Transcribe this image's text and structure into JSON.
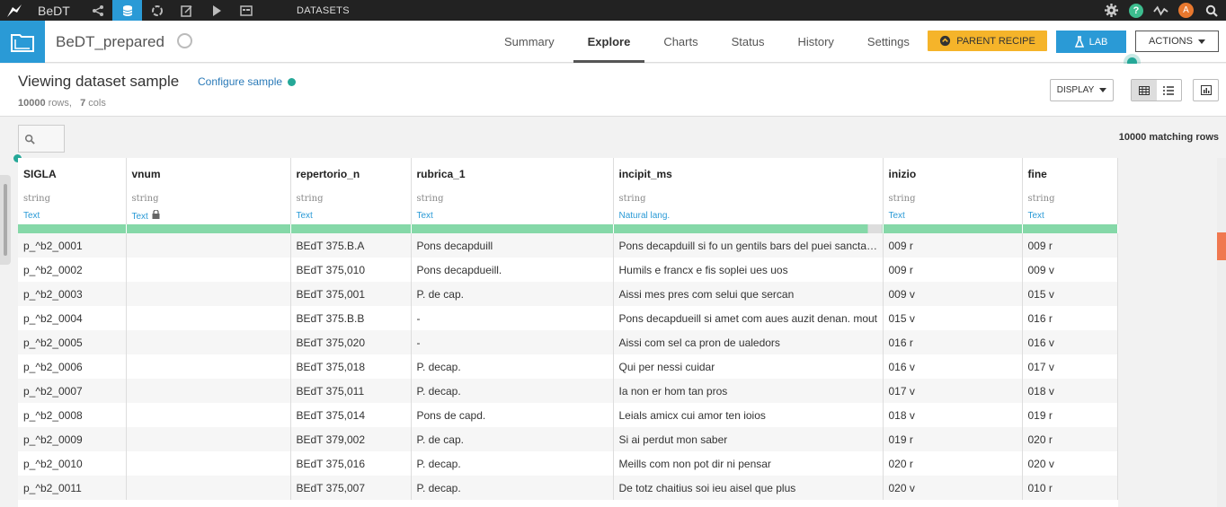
{
  "topbar": {
    "project_name": "BeDT",
    "section_label": "DATASETS"
  },
  "dataset": {
    "name": "BeDT_prepared"
  },
  "tabs": [
    {
      "label": "Summary"
    },
    {
      "label": "Explore"
    },
    {
      "label": "Charts"
    },
    {
      "label": "Status"
    },
    {
      "label": "History"
    },
    {
      "label": "Settings"
    }
  ],
  "active_tab": "Explore",
  "buttons": {
    "parent_recipe": "PARENT RECIPE",
    "lab": "LAB",
    "actions": "ACTIONS",
    "display": "DISPLAY"
  },
  "sample": {
    "title": "Viewing dataset sample",
    "configure": "Configure sample",
    "rows_count": "10000",
    "rows_label": "rows,",
    "cols_count": "7",
    "cols_label": "cols"
  },
  "matching": "10000 matching rows",
  "colors": {
    "accent": "#2a9ad6",
    "parent_recipe": "#f5b42a",
    "quality": "#85d8a8",
    "teal_dot": "#25a898",
    "avatar": "#e8782e"
  },
  "avatar_letter": "A",
  "help_symbol": "?",
  "columns": [
    {
      "name": "SIGLA",
      "type": "string",
      "meaning": "Text"
    },
    {
      "name": "vnum",
      "type": "string",
      "meaning": "Text"
    },
    {
      "name": "repertorio_n",
      "type": "string",
      "meaning": "Text"
    },
    {
      "name": "rubrica_1",
      "type": "string",
      "meaning": "Text"
    },
    {
      "name": "incipit_ms",
      "type": "string",
      "meaning": "Natural lang."
    },
    {
      "name": "inizio",
      "type": "string",
      "meaning": "Text"
    },
    {
      "name": "fine",
      "type": "string",
      "meaning": "Text"
    }
  ],
  "rows": [
    [
      "p_^b2_0001",
      "",
      "BEdT 375.B.A",
      "Pons decapduill",
      "Pons decapduill si fo un gentils bars del puei sanctamaria",
      "009 r",
      "009 r"
    ],
    [
      "p_^b2_0002",
      "",
      "BEdT 375,010",
      "Pons decapdueill.",
      "Humils e francx e fis soplei ues uos",
      "009 r",
      "009 v"
    ],
    [
      "p_^b2_0003",
      "",
      "BEdT 375,001",
      "P. de cap.",
      "Aissi mes pres com selui que sercan",
      "009 v",
      "015 v"
    ],
    [
      "p_^b2_0004",
      "",
      "BEdT 375.B.B",
      "-",
      "Pons decapdueill si amet com aues auzit denan. mout",
      "015 v",
      "016 r"
    ],
    [
      "p_^b2_0005",
      "",
      "BEdT 375,020",
      "-",
      "Aissi com sel ca pron de ualedors",
      "016 r",
      "016 v"
    ],
    [
      "p_^b2_0006",
      "",
      "BEdT 375,018",
      "P. decap.",
      "Qui per nessi cuidar",
      "016 v",
      "017 v"
    ],
    [
      "p_^b2_0007",
      "",
      "BEdT 375,011",
      "P. decap.",
      "Ia non er hom tan pros",
      "017 v",
      "018 v"
    ],
    [
      "p_^b2_0008",
      "",
      "BEdT 375,014",
      "Pons de capd.",
      "Leials amicx cui amor ten ioios",
      "018 v",
      "019 r"
    ],
    [
      "p_^b2_0009",
      "",
      "BEdT 379,002",
      "P. de cap.",
      "Si ai perdut mon saber",
      "019 r",
      "020 r"
    ],
    [
      "p_^b2_0010",
      "",
      "BEdT 375,016",
      "P. decap.",
      "Meills com non pot dir ni pensar",
      "020 r",
      "020 v"
    ],
    [
      "p_^b2_0011",
      "",
      "BEdT 375,007",
      "P. decap.",
      "De totz chaitius soi ieu aisel que plus",
      "020 v",
      "010 r"
    ]
  ]
}
